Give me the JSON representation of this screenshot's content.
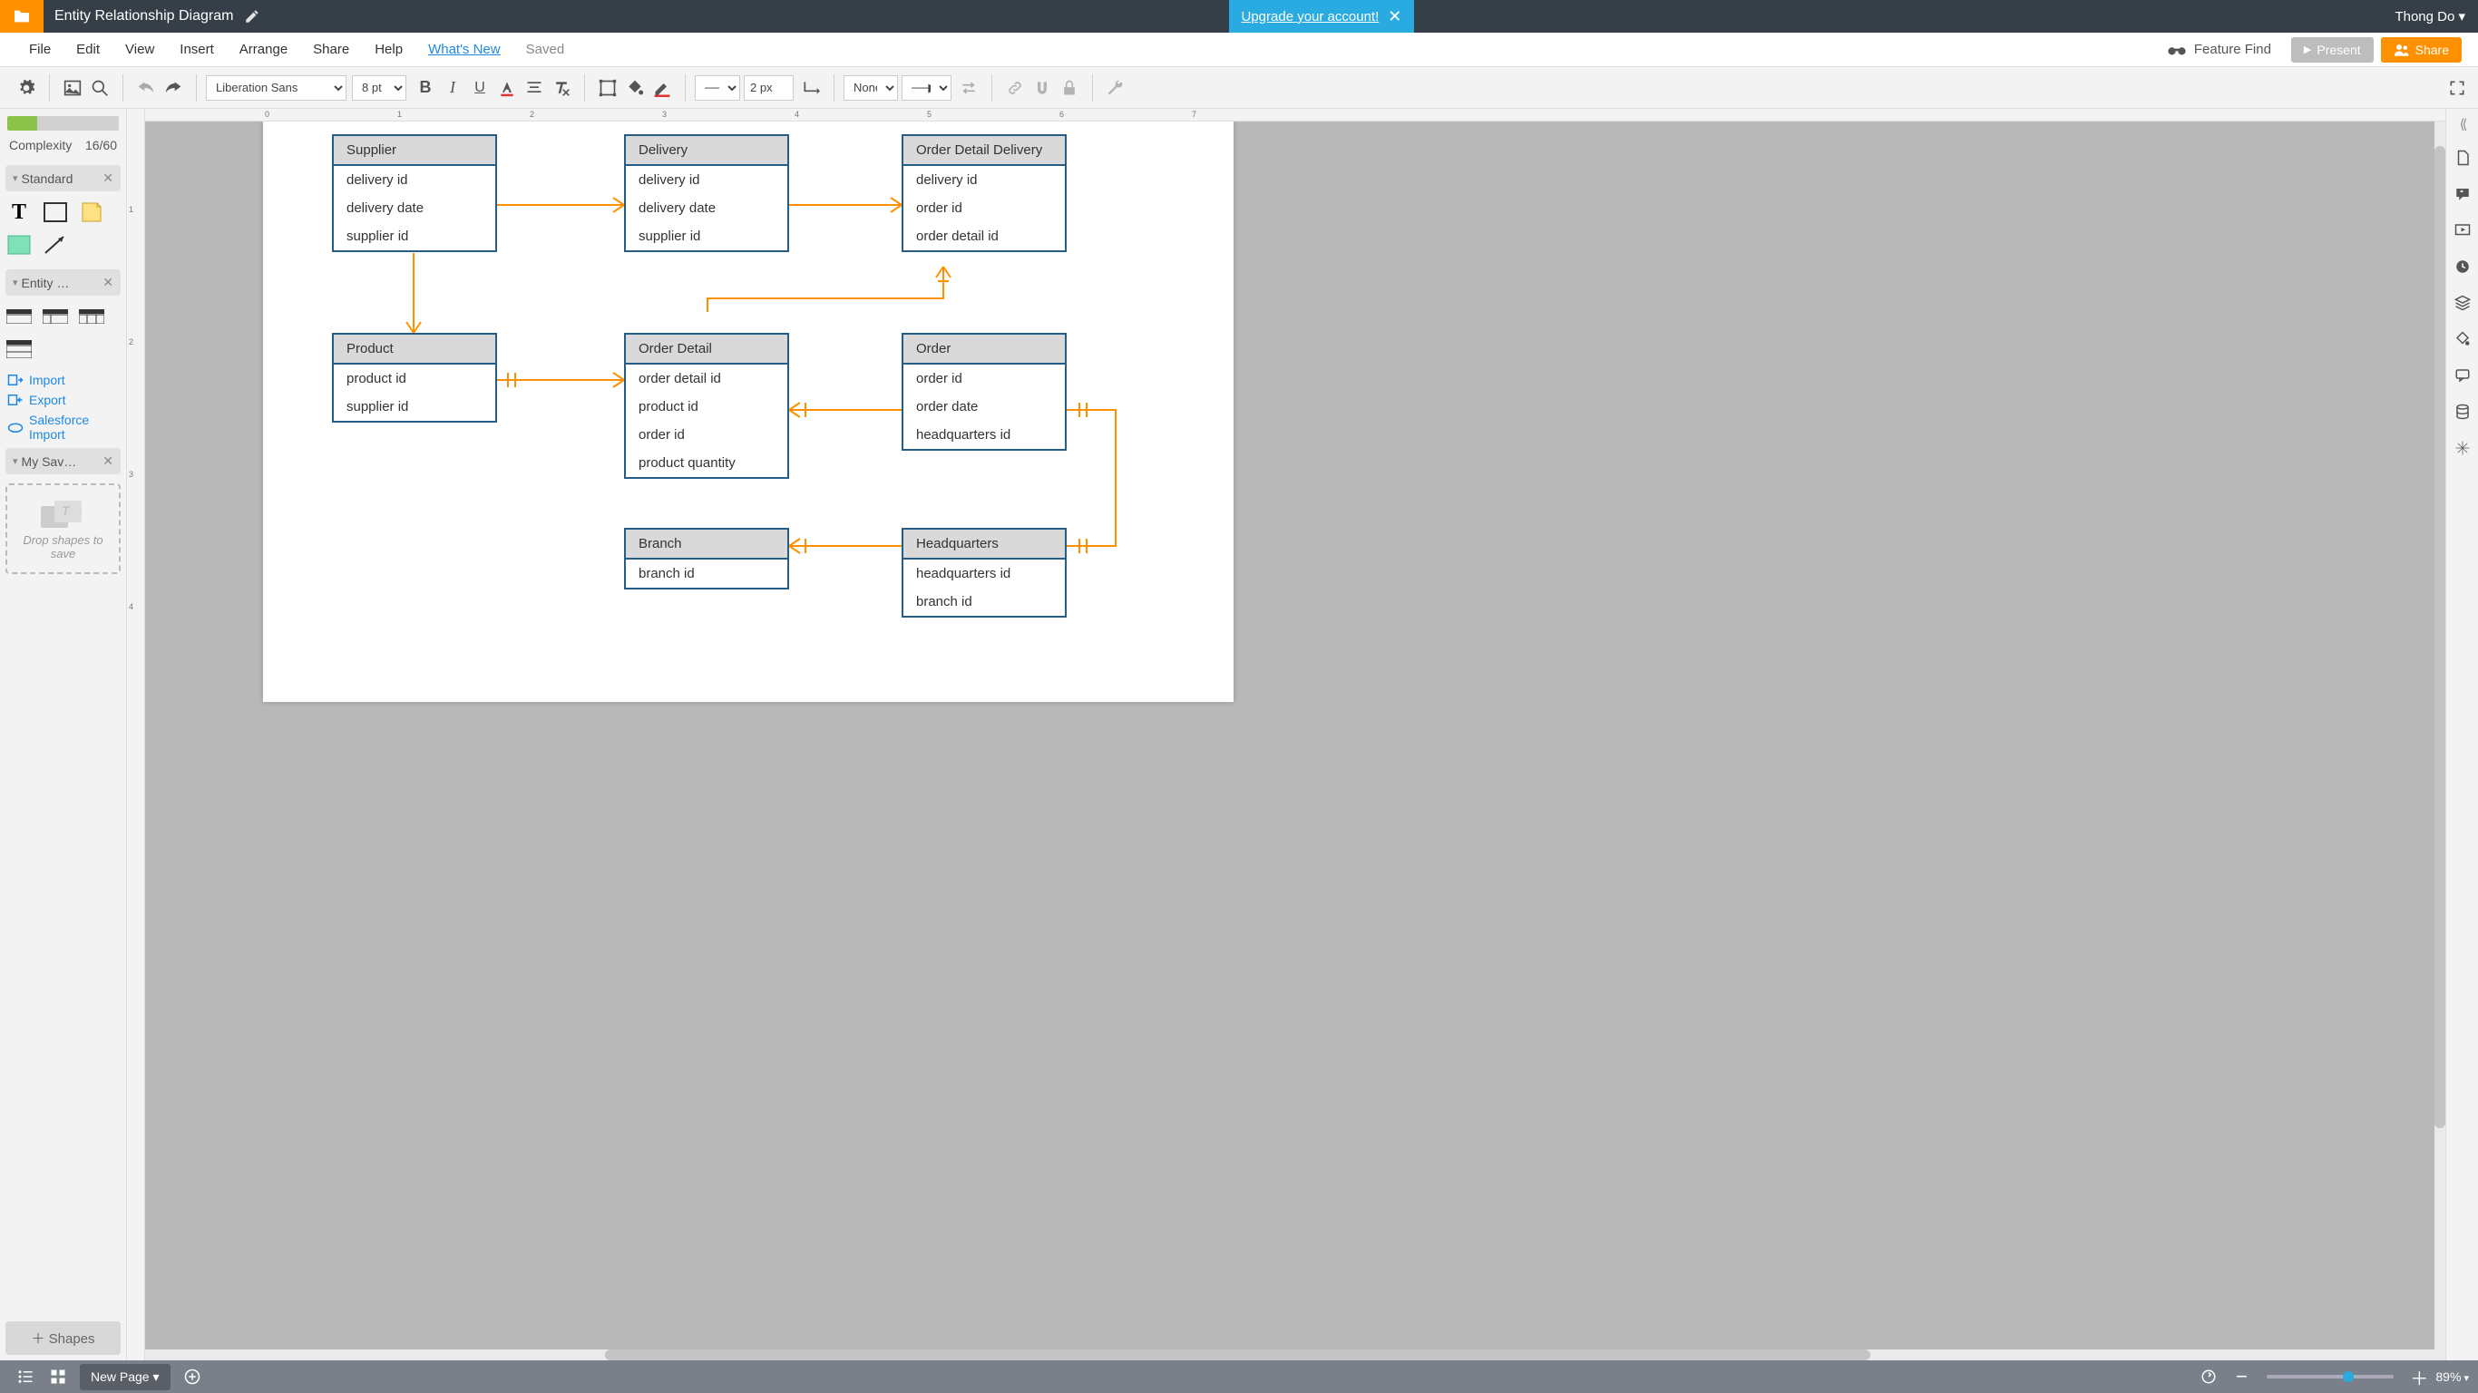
{
  "header": {
    "doc_title": "Entity Relationship Diagram",
    "upgrade_text": "Upgrade your account!",
    "user_name": "Thong Do"
  },
  "menubar": {
    "items": [
      "File",
      "Edit",
      "View",
      "Insert",
      "Arrange",
      "Share",
      "Help"
    ],
    "whats_new": "What's New",
    "saved": "Saved",
    "feature_find": "Feature Find",
    "present": "Present",
    "share": "Share"
  },
  "toolbar": {
    "font": "Liberation Sans",
    "font_size": "8 pt",
    "line_width": "2 px",
    "line_end": "None"
  },
  "left": {
    "complexity_label": "Complexity",
    "complexity_value": "16/60",
    "cat_standard": "Standard",
    "cat_entity": "Entity …",
    "cat_saved": "My Sav…",
    "import": "Import",
    "export": "Export",
    "salesforce": "Salesforce Import",
    "drop_hint": "Drop shapes to save",
    "shapes_btn": "Shapes"
  },
  "entities": {
    "supplier": {
      "title": "Supplier",
      "rows": [
        "delivery id",
        "delivery date",
        "supplier id"
      ]
    },
    "delivery": {
      "title": "Delivery",
      "rows": [
        "delivery id",
        "delivery date",
        "supplier id"
      ]
    },
    "odd": {
      "title": "Order Detail Delivery",
      "rows": [
        "delivery id",
        "order id",
        "order detail id"
      ]
    },
    "product": {
      "title": "Product",
      "rows": [
        "product id",
        "supplier id"
      ]
    },
    "orderdetail": {
      "title": "Order Detail",
      "rows": [
        "order detail id",
        "product id",
        "order id",
        "product quantity"
      ]
    },
    "order": {
      "title": "Order",
      "rows": [
        "order id",
        "order date",
        "headquarters id"
      ]
    },
    "branch": {
      "title": "Branch",
      "rows": [
        "branch id"
      ]
    },
    "hq": {
      "title": "Headquarters",
      "rows": [
        "headquarters id",
        "branch id"
      ]
    }
  },
  "bottom": {
    "page_tab": "New Page",
    "zoom": "89%"
  },
  "chart_data": {
    "type": "erd",
    "entities": [
      {
        "name": "Supplier",
        "attributes": [
          "delivery id",
          "delivery date",
          "supplier id"
        ]
      },
      {
        "name": "Delivery",
        "attributes": [
          "delivery id",
          "delivery date",
          "supplier id"
        ]
      },
      {
        "name": "Order Detail Delivery",
        "attributes": [
          "delivery id",
          "order id",
          "order detail id"
        ]
      },
      {
        "name": "Product",
        "attributes": [
          "product id",
          "supplier id"
        ]
      },
      {
        "name": "Order Detail",
        "attributes": [
          "order detail id",
          "product id",
          "order id",
          "product quantity"
        ]
      },
      {
        "name": "Order",
        "attributes": [
          "order id",
          "order date",
          "headquarters id"
        ]
      },
      {
        "name": "Branch",
        "attributes": [
          "branch id"
        ]
      },
      {
        "name": "Headquarters",
        "attributes": [
          "headquarters id",
          "branch id"
        ]
      }
    ],
    "relationships": [
      {
        "from": "Supplier",
        "to": "Delivery",
        "from_card": "one",
        "to_card": "many"
      },
      {
        "from": "Delivery",
        "to": "Order Detail Delivery",
        "from_card": "one",
        "to_card": "many"
      },
      {
        "from": "Supplier",
        "to": "Product",
        "from_card": "one",
        "to_card": "many"
      },
      {
        "from": "Product",
        "to": "Order Detail",
        "from_card": "one-and-only-one",
        "to_card": "many"
      },
      {
        "from": "Order Detail",
        "to": "Order",
        "from_card": "many",
        "to_card": "one"
      },
      {
        "from": "Order Detail Delivery",
        "to": "Order Detail",
        "from_card": "one",
        "to_card": "many-optional"
      },
      {
        "from": "Order",
        "to": "Headquarters",
        "from_card": "one-and-only-one",
        "to_card": "one-and-only-one"
      },
      {
        "from": "Branch",
        "to": "Headquarters",
        "from_card": "many",
        "to_card": "one"
      }
    ]
  }
}
